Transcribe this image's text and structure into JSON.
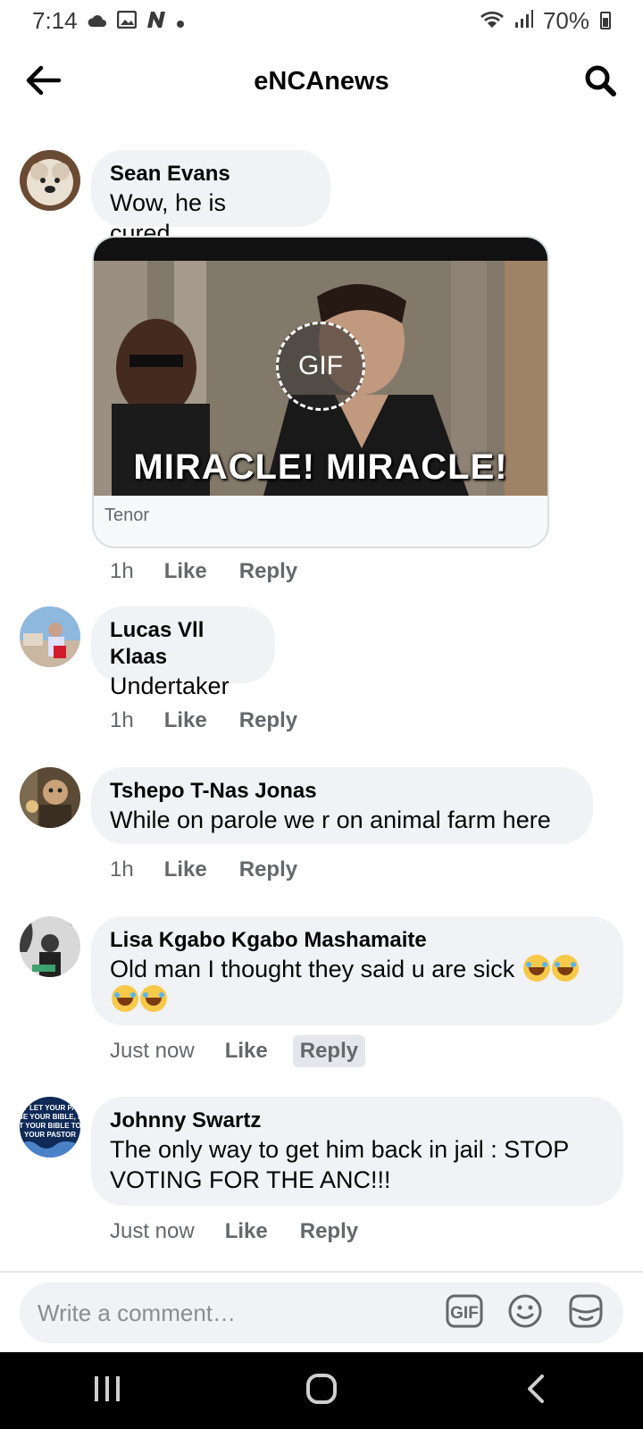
{
  "status_bar": {
    "time": "7:14",
    "battery": "70%",
    "left_icons": [
      "cloud-icon",
      "image-icon",
      "n-app-icon",
      "dot-icon"
    ],
    "right_icons": [
      "wifi-icon",
      "signal-icon",
      "battery-icon"
    ]
  },
  "header": {
    "title": "eNCAnews",
    "back_icon": "arrow-left-icon",
    "search_icon": "search-icon"
  },
  "comments": [
    {
      "author": "Sean Evans",
      "text": "Wow, he is cured…",
      "time": "1h",
      "like": "Like",
      "reply": "Reply",
      "gif": {
        "badge": "GIF",
        "caption": "MIRACLE! MIRACLE!",
        "source": "Tenor"
      }
    },
    {
      "author": "Lucas Vll Klaas",
      "text": "Undertaker",
      "time": "1h",
      "like": "Like",
      "reply": "Reply"
    },
    {
      "author": "Tshepo T-Nas Jonas",
      "text": "While on parole we r on animal farm  here",
      "time": "1h",
      "like": "Like",
      "reply": "Reply"
    },
    {
      "author": "Lisa Kgabo Kgabo Mashamaite",
      "text": "Old man I thought they said u are sick",
      "emoji": "face-with-tears-of-joy-icon",
      "time": "Just now",
      "like": "Like",
      "reply": "Reply"
    },
    {
      "author": "Johnny Swartz",
      "text": "The only way to get him back in jail : STOP VOTING FOR THE ANC!!!",
      "time": "Just now",
      "like": "Like",
      "reply": "Reply",
      "avatar_text": [
        "T LET YOUR PA",
        "BE YOUR BIBLE, L",
        "T YOUR BIBLE TO",
        "YOUR PASTOR"
      ]
    }
  ],
  "composer": {
    "placeholder": "Write a comment…",
    "icons": [
      "gif-icon",
      "emoji-icon",
      "sticker-icon"
    ]
  },
  "nav_bar": {
    "icons": [
      "recent-apps-icon",
      "home-icon",
      "back-icon"
    ]
  },
  "colors": {
    "bubble": "#f0f2f5",
    "meta_text": "#65676b",
    "primary_text": "#050505",
    "nav_bar": "#000000"
  }
}
